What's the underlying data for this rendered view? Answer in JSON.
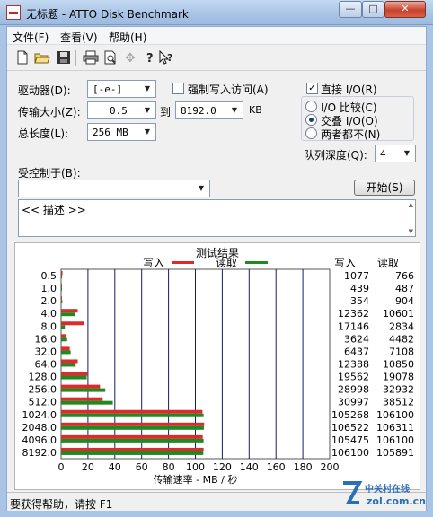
{
  "window": {
    "title": "无标题 - ATTO Disk Benchmark",
    "min_glyph": "—",
    "max_glyph": "□",
    "close_glyph": "✕"
  },
  "menu": {
    "items": [
      "文件(F)",
      "查看(V)",
      "帮助(H)"
    ]
  },
  "toolbar": {
    "icons": [
      "new-file-icon",
      "open-folder-icon",
      "save-icon",
      "print-icon",
      "print-preview-icon",
      "move-icon",
      "help-icon",
      "context-help-icon"
    ]
  },
  "settings": {
    "drive_label": "驱动器(D):",
    "drive_value": "[-e-]",
    "force_write_label": "强制写入访问(A)",
    "force_write_checked": false,
    "transfer_label": "传输大小(Z):",
    "transfer_from": "0.5",
    "transfer_to_label": "到",
    "transfer_to": "8192.0",
    "transfer_unit": "KB",
    "total_length_label": "总长度(L):",
    "total_length_value": "256 MB",
    "direct_io_label": "直接 I/O(R)",
    "direct_io_checked": true,
    "io_compare_label": "I/O 比较(C)",
    "overlapped_io_label": "交叠 I/O(O)",
    "neither_label": "两者都不(N)",
    "io_mode_selected": "overlapped",
    "queue_depth_label": "队列深度(Q):",
    "queue_depth_value": "4",
    "controlled_by_label": "受控制于(B):",
    "controlled_by_value": "",
    "start_button": "开始(S)",
    "description": "<< 描述 >>"
  },
  "results": {
    "title": "测试结果",
    "write_legend": "写入",
    "read_legend": "读取",
    "write_header": "写入",
    "read_header": "读取"
  },
  "colors": {
    "write": "#dd2a2a",
    "read": "#1f8a22",
    "grid": "#1a1a66"
  },
  "chart_data": {
    "type": "bar",
    "orientation": "horizontal",
    "categories": [
      "0.5",
      "1.0",
      "2.0",
      "4.0",
      "8.0",
      "16.0",
      "32.0",
      "64.0",
      "128.0",
      "256.0",
      "512.0",
      "1024.0",
      "2048.0",
      "4096.0",
      "8192.0"
    ],
    "series": [
      {
        "name": "写入",
        "values": [
          1077,
          439,
          354,
          12362,
          17146,
          3624,
          6437,
          12388,
          19562,
          28998,
          30997,
          105268,
          106522,
          105475,
          106100
        ]
      },
      {
        "name": "读取",
        "values": [
          766,
          487,
          904,
          10601,
          2834,
          4482,
          7108,
          10850,
          19078,
          32932,
          38512,
          106100,
          106311,
          106100,
          105891
        ]
      }
    ],
    "x_ticks": [
      "0",
      "20",
      "40",
      "60",
      "80",
      "100",
      "120",
      "140",
      "160",
      "180",
      "200"
    ],
    "xlabel": "传输速率 - MB / 秒",
    "xlim": [
      0,
      200
    ],
    "value_unit_divisor": 1000,
    "grid": true,
    "legend": "top-center"
  },
  "status": {
    "text": "要获得帮助，请按 F1"
  },
  "watermark": {
    "text": "中关村在线",
    "sub": "zol.com.cn"
  }
}
